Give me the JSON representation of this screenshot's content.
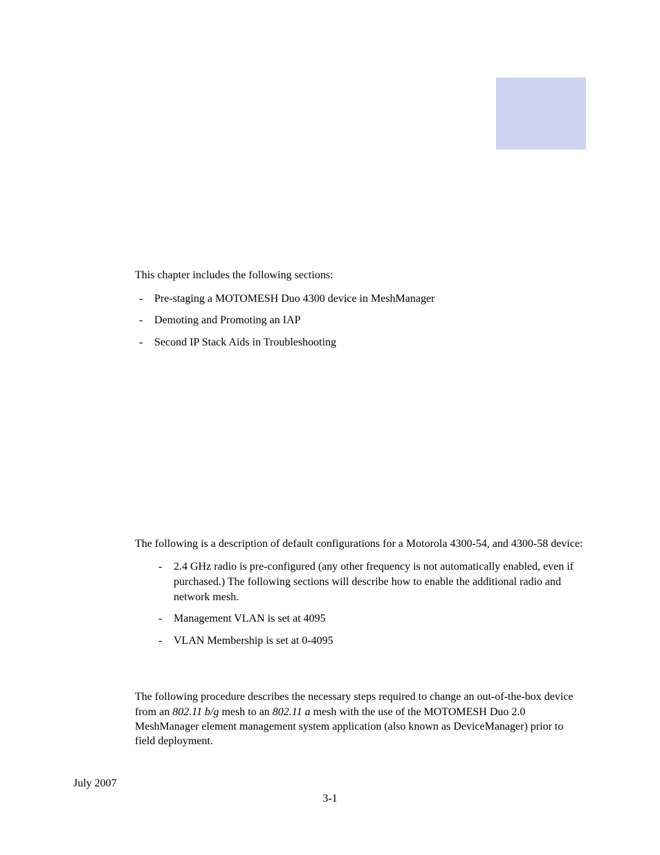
{
  "intro": "This chapter includes the following sections:",
  "sections_list": [
    "Pre-staging a MOTOMESH Duo 4300 device in MeshManager",
    "Demoting and Promoting an IAP",
    "Second IP Stack Aids in Troubleshooting"
  ],
  "defaults_intro": "The following is a description of default configurations for a Motorola 4300-54, and 4300-58 device:",
  "defaults_list": [
    "2.4 GHz radio is pre-configured (any other frequency is not automatically enabled, even if purchased.) The following sections will describe how to enable the additional radio and network mesh.",
    "Management VLAN is set at 4095",
    "VLAN Membership is set at 0-4095"
  ],
  "procedure_para": {
    "pre1": "The following procedure describes the necessary steps required to change an out-of-the-box device from an ",
    "italic1": "802.11 b/g",
    "mid1": " mesh to an ",
    "italic2": "802.11 a",
    "post1": " mesh with the use of the MOTOMESH Duo 2.0 MeshManager element management system application (also known as DeviceManager) prior to field deployment."
  },
  "footer_date": "July 2007",
  "footer_page": "3-1"
}
